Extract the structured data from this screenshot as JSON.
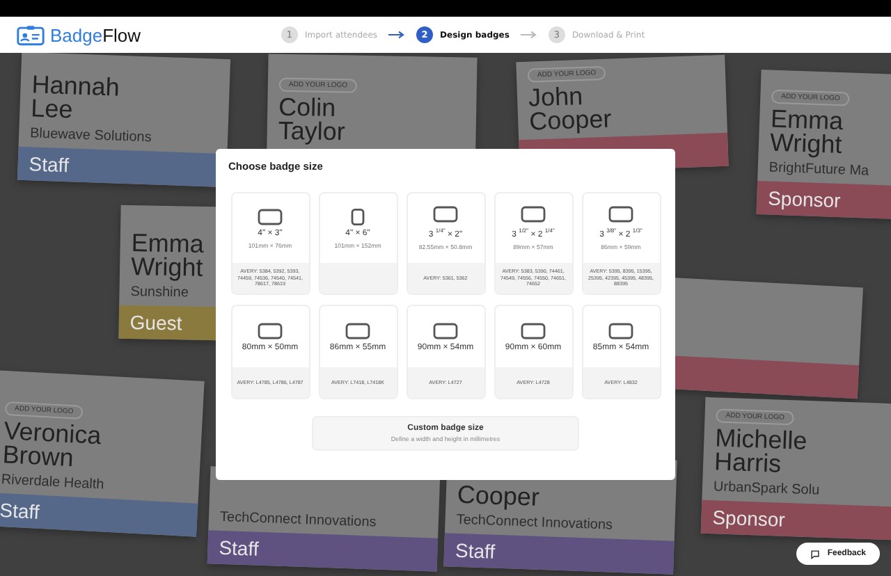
{
  "app": {
    "logo_first": "Badge",
    "logo_second": "Flow"
  },
  "steps": [
    {
      "number": "1",
      "label": "Import attendees",
      "selected": false
    },
    {
      "number": "2",
      "label": "Design badges",
      "selected": true
    },
    {
      "number": "3",
      "label": "Download & Print",
      "selected": false
    }
  ],
  "badges": [
    {
      "name": [
        "Hannah",
        "Lee"
      ],
      "company": "Bluewave Solutions",
      "role": "Staff",
      "color": "#55688a"
    },
    {
      "logo": "ADD YOUR LOGO",
      "name": [
        "Colin",
        "Taylor"
      ]
    },
    {
      "logo": "ADD YOUR LOGO",
      "name": [
        "John",
        "Cooper"
      ],
      "color": "#8a4a56"
    },
    {
      "logo": "ADD YOUR LOGO",
      "name": [
        "Emma",
        "Wright"
      ],
      "company": "BrightFuture Ma",
      "role": "Sponsor",
      "color": "#8a4a56"
    },
    {
      "name": [
        "Emma",
        "Wright"
      ],
      "company": "Sunshine",
      "role": "Guest",
      "color": "#8a7a3e"
    },
    {
      "color": "#8a4a56"
    },
    {
      "logo": "ADD YOUR LOGO",
      "name": [
        "Veronica",
        "Brown"
      ],
      "company": "Riverdale Health",
      "role": "Staff",
      "color": "#55688a"
    },
    {
      "company": "TechConnect Innovations",
      "role": "Staff",
      "color": "#5f5280"
    },
    {
      "name": [
        "Cooper"
      ],
      "company": "TechConnect Innovations",
      "role": "Staff",
      "color": "#5f5280"
    },
    {
      "logo": "ADD YOUR LOGO",
      "name": [
        "Michelle",
        "Harris"
      ],
      "company": "UrbanSpark Solu",
      "role": "Sponsor",
      "color": "#8a4a56"
    }
  ],
  "dialog": {
    "title": "Choose badge size",
    "sizes": [
      {
        "kind": "landscape",
        "title": "4\" × 3\"",
        "metric": "101mm × 76mm",
        "avery": "AVERY: 5384, 5392, 5393, 74459, 74536, 74540, 74541, 78617, 78619"
      },
      {
        "kind": "portrait",
        "title": "4\" × 6\"",
        "metric": "101mm × 152mm"
      },
      {
        "kind": "landscape",
        "title": "3 $^{1/4\"}$ × 2\"",
        "metric": "82.55mm × 50.8mm",
        "avery": "AVERY: 5361, 5362"
      },
      {
        "kind": "landscape",
        "title": "3 $^{1/2\"}$ × 2 $^{1/4\"}$",
        "metric": "89mm × 57mm",
        "avery": "AVERY: 5383, 5390, 74461, 74549, 74556, 74550, 74651, 74652"
      },
      {
        "kind": "landscape",
        "title": "3 $^{3/8\"}$ × 2 $^{1/3\"}$",
        "metric": "86mm × 59mm",
        "avery": "AVERY: 5395, 8395, 15395, 25395, 42395, 45395, 48395, 88395"
      },
      {
        "kind": "landscape",
        "title": "80mm × 50mm",
        "avery": "AVERY: L4785, L4786, L4787"
      },
      {
        "kind": "landscape",
        "title": "86mm × 55mm",
        "avery": "AVERY: L7418, L7418K"
      },
      {
        "kind": "landscape",
        "title": "90mm × 54mm",
        "avery": "AVERY: L4727"
      },
      {
        "kind": "landscape",
        "title": "90mm × 60mm",
        "avery": "AVERY: L4728"
      },
      {
        "kind": "landscape",
        "title": "85mm × 54mm",
        "avery": "AVERY: L4832"
      }
    ],
    "custom": {
      "title": "Custom badge size",
      "subtitle": "Define a width and height in millimetres"
    }
  },
  "feedback": "Feedback"
}
